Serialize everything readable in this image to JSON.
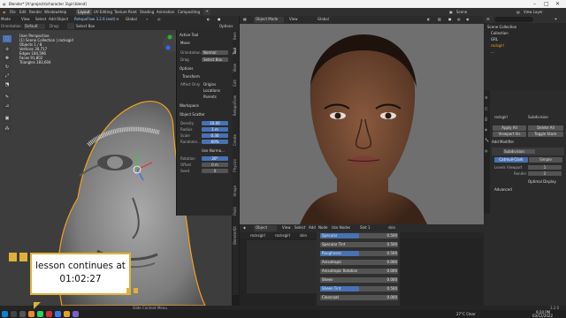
{
  "titlebar": {
    "title": "Blender* [A:\\projects\\character 3\\girl.blend]",
    "minimize": "–",
    "maximize": "□",
    "close": "✕"
  },
  "menubar": {
    "items": [
      "File",
      "Edit",
      "Render",
      "Window",
      "Help"
    ],
    "tabs": [
      "Layout",
      "UV Editing",
      "Texture Paint",
      "Shading",
      "Animation",
      "Compositing"
    ],
    "active_tab": "Layout",
    "scene_label": "Scene",
    "view_layer_label": "View Layer"
  },
  "left_editor": {
    "header": {
      "mode": "Mode",
      "view": "View",
      "select": "Select",
      "add": "Add",
      "object": "Object",
      "retopo": "RetopoFlow 3.2.6 (exit)",
      "orient": "Global"
    },
    "header2": {
      "orientation_label": "Orientation:",
      "orientation_value": "Default",
      "drag_label": "Drag:",
      "drag_value": "Select Box",
      "options": "Options"
    },
    "info": [
      "User Perspective",
      "(1) Scene Collection | rocksgirl",
      "",
      "Objects   1 / 8",
      "Vertices  30,717",
      "Edges     184,596",
      "Faces     91,802",
      "Triangles 183,604"
    ],
    "npanel": {
      "active_tool": "Active Tool",
      "move": "Move",
      "orientation": "Orientation",
      "orientation_value": "Normal",
      "drag": "Drag",
      "drag_value": "Select Box",
      "options": "Options",
      "transform": "Transform",
      "affect_only": "Affect Only",
      "origins": "Origins",
      "locations": "Locations",
      "parents": "Parents",
      "workspace": "Workspace",
      "object_scatter": "Object Scatter",
      "rows": [
        {
          "label": "Density",
          "value": "10.00"
        },
        {
          "label": "Radius",
          "value": "1 m"
        },
        {
          "label": "Scale",
          "value": "0.30"
        },
        {
          "label": "Randomn...",
          "value": "60%"
        }
      ],
      "use_normal": "Use Norma...",
      "rows2": [
        {
          "label": "Rotation",
          "value": "20°"
        },
        {
          "label": "Offset",
          "value": "0 m"
        },
        {
          "label": "Seed",
          "value": "0"
        }
      ]
    },
    "vtabs": [
      "Item",
      "Tool",
      "View",
      "Edit",
      "RetopoFlow",
      "Create",
      "Physics",
      "Image",
      "Paint",
      "BlenderKit"
    ]
  },
  "middle_editor": {
    "header": {
      "object_mode": "Object Mode",
      "view": "View",
      "global": "Global"
    },
    "node_header": {
      "object": "Object",
      "view": "View",
      "select": "Select",
      "add": "Add",
      "node": "Node",
      "use_nodes": "Use Nodes",
      "slot": "Slot 1",
      "material": "skin"
    },
    "node_breadcrumb": [
      "rocksgirl",
      "rocksgirl",
      "skin"
    ],
    "shader_rows": [
      {
        "label": "Specular",
        "value": "0.500",
        "fill": 0.5,
        "highlight": true
      },
      {
        "label": "Specular Tint",
        "value": "0.500",
        "fill": 0.0,
        "highlight": false
      },
      {
        "label": "Roughness",
        "value": "0.500",
        "fill": 0.5,
        "highlight": true
      },
      {
        "label": "Anisotropic",
        "value": "0.000",
        "fill": 0.0,
        "highlight": false
      },
      {
        "label": "Anisotropic Rotation",
        "value": "0.000",
        "fill": 0.0,
        "highlight": false
      },
      {
        "label": "Sheen",
        "value": "0.000",
        "fill": 0.0,
        "highlight": false
      },
      {
        "label": "Sheen Tint",
        "value": "0.500",
        "fill": 0.5,
        "highlight": true
      },
      {
        "label": "Clearcoat",
        "value": "0.000",
        "fill": 0.0,
        "highlight": false
      }
    ]
  },
  "outliner": {
    "title": "Scene Collection",
    "items": [
      "Collection",
      "GRL",
      "rockgirl",
      "..."
    ]
  },
  "properties": {
    "object_name": "rockgirl",
    "modifier_label": "Subdivision",
    "apply_all": "Apply All",
    "delete_all": "Delete All",
    "viewport_vis": "Viewport Vis",
    "toggle_stack": "Toggle Stack",
    "add_modifier": "Add Modifier",
    "subdivision": "Subdivision",
    "catmull": "Catmull-Clark",
    "simple": "Simple",
    "levels_viewport_label": "Levels Viewport",
    "levels_viewport": "1",
    "render_label": "Render",
    "render": "2",
    "optimal_display": "Optimal Display",
    "advanced": "Advanced"
  },
  "statusbar": {
    "text": "Slide Context Menu",
    "version": "3.2.0"
  },
  "taskbar": {
    "weather": "27°C Clear",
    "time": "9:20 PM",
    "date": "03/12/2022"
  },
  "overlay": {
    "lesson": "lesson continues at 01:02:27"
  },
  "colors": {
    "accent": "#4772b3",
    "overlay_border": "#e0b13a",
    "selection": "#f0a020"
  }
}
